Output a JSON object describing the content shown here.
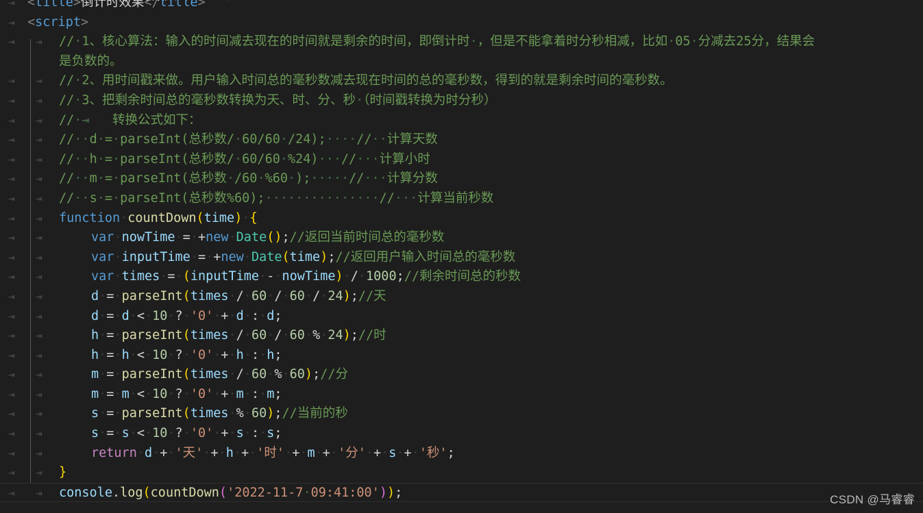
{
  "app": {
    "name": "Visual Studio Code",
    "theme": "Dark+ (default dark)",
    "language": "HTML / JavaScript",
    "background_color": "#1e1e1e",
    "foreground_color": "#d4d4d4"
  },
  "colors": {
    "editor_background": "#1e1e1e",
    "comment": "#6a9955",
    "keyword": "#569cd6",
    "control_keyword": "#c586c0",
    "function": "#dcdcaa",
    "variable": "#9cdcfe",
    "number": "#b5cea8",
    "string": "#ce9178",
    "class": "#4ec9b0",
    "whitespace_marker": "#3b3b3b",
    "indent_guide": "#5a5a5a",
    "current_line_border": "#303030"
  },
  "watermark": {
    "text": "CSDN @马睿睿"
  },
  "gutter": {
    "tab_arrow": "⇥"
  },
  "code": {
    "lines": [
      {
        "id": "line-clipped-top",
        "indent": 1,
        "visible_partial": true,
        "text": "<title>倒计时效果</title>"
      },
      {
        "id": "line-title",
        "indent": 1,
        "text": "<title>倒计时效果</title>"
      },
      {
        "id": "line-script",
        "indent": 1,
        "text": "<script>"
      },
      {
        "id": "line-c1a",
        "indent": 2,
        "text": "// 1、核心算法：输入的时间减去现在的时间就是剩余的时间，即倒计时 ，但是不能拿着时分秒相减，比如 05 分减去25分，结果会"
      },
      {
        "id": "line-c1b",
        "indent": 2,
        "wrapped": true,
        "text": "是负数的。"
      },
      {
        "id": "line-c2",
        "indent": 2,
        "text": "// 2、用时间戳来做。用户输入时间总的毫秒数减去现在时间的总的毫秒数，得到的就是剩余时间的毫秒数。"
      },
      {
        "id": "line-c3",
        "indent": 2,
        "text": "// 3、把剩余时间总的毫秒数转换为天、时、分、秒 （时间戳转换为时分秒）"
      },
      {
        "id": "line-c4",
        "indent": 2,
        "text": "// ⇥    转换公式如下："
      },
      {
        "id": "line-c5",
        "indent": 2,
        "text": "// d = parseInt(总秒数/ 60/60 /24);    // 计算天数"
      },
      {
        "id": "line-c6",
        "indent": 2,
        "text": "// h = parseInt(总秒数/ 60/60 %24)   // 计算小时"
      },
      {
        "id": "line-c7",
        "indent": 2,
        "text": "// m = parseInt(总秒数 /60 %60 );     // 计算分数"
      },
      {
        "id": "line-c8",
        "indent": 2,
        "text": "// s = parseInt(总秒数%60);              // 计算当前秒数"
      },
      {
        "id": "line-fn",
        "indent": 2,
        "text": "function countDown(time) {"
      },
      {
        "id": "line-now",
        "indent": 3,
        "text": "var nowTime = +new Date();//返回当前时间总的毫秒数"
      },
      {
        "id": "line-input",
        "indent": 3,
        "text": "var inputTime = +new Date(time);//返回用户输入时间总的毫秒数"
      },
      {
        "id": "line-times",
        "indent": 3,
        "text": "var times = (inputTime - nowTime) / 1000;//剩余时间总的秒数"
      },
      {
        "id": "line-d1",
        "indent": 3,
        "text": "d = parseInt(times / 60 / 60 / 24);//天"
      },
      {
        "id": "line-d2",
        "indent": 3,
        "text": "d = d < 10 ? '0' + d : d;"
      },
      {
        "id": "line-h1",
        "indent": 3,
        "text": "h = parseInt(times / 60 / 60 % 24);//时"
      },
      {
        "id": "line-h2",
        "indent": 3,
        "text": "h = h < 10 ? '0' + h : h;"
      },
      {
        "id": "line-m1",
        "indent": 3,
        "text": "m = parseInt(times / 60 % 60);//分"
      },
      {
        "id": "line-m2",
        "indent": 3,
        "text": "m = m < 10 ? '0' + m : m;"
      },
      {
        "id": "line-s1",
        "indent": 3,
        "text": "s = parseInt(times % 60);//当前的秒"
      },
      {
        "id": "line-s2",
        "indent": 3,
        "text": "s = s < 10 ? '0' + s : s;"
      },
      {
        "id": "line-return",
        "indent": 3,
        "text": "return d + '天' + h + '时' + m + '分' + s + '秒';"
      },
      {
        "id": "line-close",
        "indent": 2,
        "text": "}"
      },
      {
        "id": "line-console",
        "indent": 2,
        "current": true,
        "text": "console.log(countDown('2022-11-7 09:41:00'));"
      }
    ]
  },
  "literals": {
    "title_text": "倒计时效果",
    "countdown_fn_name": "countDown",
    "param_name": "time",
    "input_date": "2022-11-7 09:41:00",
    "day_unit": "天",
    "hour_unit": "时",
    "minute_unit": "分",
    "second_unit": "秒",
    "pad_zero": "0",
    "threshold": "10",
    "ms_divisor": "1000",
    "sixty": "60",
    "twentyfour": "24"
  }
}
